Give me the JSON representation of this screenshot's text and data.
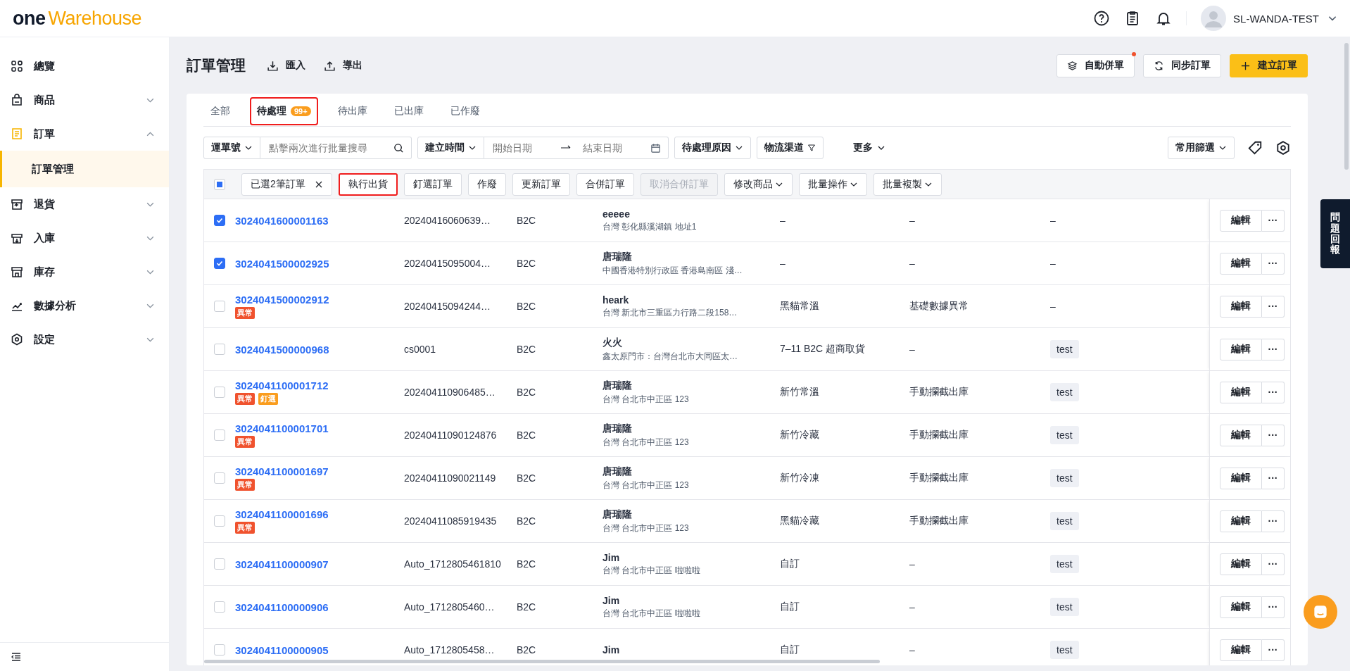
{
  "header": {
    "logo_one": "one",
    "logo_rest": "Warehouse",
    "user": "SL-WANDA-TEST"
  },
  "sidebar": {
    "items": [
      {
        "label": "總覽"
      },
      {
        "label": "商品",
        "expanded": false
      },
      {
        "label": "訂單",
        "expanded": true,
        "children": [
          {
            "label": "訂單管理",
            "selected": true
          }
        ]
      },
      {
        "label": "退貨",
        "expanded": false
      },
      {
        "label": "入庫",
        "expanded": false
      },
      {
        "label": "庫存",
        "expanded": false
      },
      {
        "label": "數據分析",
        "expanded": false
      },
      {
        "label": "設定",
        "expanded": false
      }
    ]
  },
  "page": {
    "title": "訂單管理",
    "import": "匯入",
    "export": "導出",
    "buttons": [
      {
        "label": "自動併單",
        "kind": "layers",
        "dot": true
      },
      {
        "label": "同步訂單",
        "kind": "sync",
        "dot": false
      },
      {
        "label": "建立訂單",
        "kind": "primary",
        "dot": false
      }
    ]
  },
  "tabs": [
    {
      "label": "全部",
      "selected": false,
      "highlighted": false
    },
    {
      "label": "待處理",
      "badge": "99+",
      "selected": true,
      "highlighted": true
    },
    {
      "label": "待出庫",
      "selected": false,
      "highlighted": false
    },
    {
      "label": "已出庫",
      "selected": false,
      "highlighted": false
    },
    {
      "label": "已作廢",
      "selected": false,
      "highlighted": false
    }
  ],
  "filters": {
    "search_type": "運單號",
    "search_placeholder": "點擊兩次進行批量搜尋",
    "date_type": "建立時間",
    "start_placeholder": "開始日期",
    "end_placeholder": "結束日期",
    "reason": "待處理原因",
    "channel": "物流渠道",
    "more": "更多",
    "saved": "常用篩選"
  },
  "bulk_bar": {
    "partially_checked": true,
    "selected_label": "已選2筆訂單",
    "actions": [
      {
        "label": "執行出貨",
        "disabled": false,
        "highlighted": true,
        "dropdown": false
      },
      {
        "label": "釘選訂單",
        "disabled": false,
        "highlighted": false,
        "dropdown": false
      },
      {
        "label": "作廢",
        "disabled": false,
        "highlighted": false,
        "dropdown": false
      },
      {
        "label": "更新訂單",
        "disabled": false,
        "highlighted": false,
        "dropdown": false
      },
      {
        "label": "合併訂單",
        "disabled": false,
        "highlighted": false,
        "dropdown": false
      },
      {
        "label": "取消合併訂單",
        "disabled": true,
        "highlighted": false,
        "dropdown": false
      },
      {
        "label": "修改商品",
        "disabled": false,
        "highlighted": false,
        "dropdown": true
      },
      {
        "label": "批量操作",
        "disabled": false,
        "highlighted": false,
        "dropdown": true
      },
      {
        "label": "批量複製",
        "disabled": false,
        "highlighted": false,
        "dropdown": true
      }
    ]
  },
  "table": {
    "rows": [
      {
        "checked": true,
        "order": "3024041600001163",
        "tags": [],
        "ref": "20240416060639…",
        "type": "B2C",
        "name": "eeeee",
        "address": "台灣 彰化縣溪湖鎮 地址1",
        "logistics": "–",
        "reason": "–",
        "tag": "–",
        "edit": "編輯",
        "more": "···"
      },
      {
        "checked": true,
        "order": "3024041500002925",
        "tags": [],
        "ref": "20240415095004…",
        "type": "B2C",
        "name": "唐瑞隆",
        "address": "中國香港特別行政區 香港島南區 淺…",
        "logistics": "–",
        "reason": "–",
        "tag": "–",
        "edit": "編輯",
        "more": "···"
      },
      {
        "checked": false,
        "order": "3024041500002912",
        "tags": [
          {
            "text": "異常",
            "kind": "error"
          }
        ],
        "ref": "20240415094244…",
        "type": "B2C",
        "name": "heark",
        "address": "台灣 新北市三重區力行路二段158…",
        "logistics": "黑貓常溫",
        "reason": "基礎數據異常",
        "tag": "–",
        "edit": "編輯",
        "more": "···"
      },
      {
        "checked": false,
        "order": "3024041500000968",
        "tags": [],
        "ref": "cs0001",
        "type": "B2C",
        "name": "火火",
        "address": "鑫太原門市：台灣台北市大同區太…",
        "logistics": "7–11 B2C 超商取貨",
        "reason": "–",
        "tag": "test",
        "edit": "編輯",
        "more": "···"
      },
      {
        "checked": false,
        "order": "3024041100001712",
        "tags": [
          {
            "text": "異常",
            "kind": "error"
          },
          {
            "text": "釘選",
            "kind": "pin"
          }
        ],
        "ref": "202404110906485…",
        "type": "B2C",
        "name": "唐瑞隆",
        "address": "台灣 台北市中正區 123",
        "logistics": "新竹常溫",
        "reason": "手動攔截出庫",
        "tag": "test",
        "edit": "編輯",
        "more": "···"
      },
      {
        "checked": false,
        "order": "3024041100001701",
        "tags": [
          {
            "text": "異常",
            "kind": "error"
          }
        ],
        "ref": "20240411090124876",
        "type": "B2C",
        "name": "唐瑞隆",
        "address": "台灣 台北市中正區 123",
        "logistics": "新竹冷藏",
        "reason": "手動攔截出庫",
        "tag": "test",
        "edit": "編輯",
        "more": "···"
      },
      {
        "checked": false,
        "order": "3024041100001697",
        "tags": [
          {
            "text": "異常",
            "kind": "error"
          }
        ],
        "ref": "20240411090021149",
        "type": "B2C",
        "name": "唐瑞隆",
        "address": "台灣 台北市中正區 123",
        "logistics": "新竹冷凍",
        "reason": "手動攔截出庫",
        "tag": "test",
        "edit": "編輯",
        "more": "···"
      },
      {
        "checked": false,
        "order": "3024041100001696",
        "tags": [
          {
            "text": "異常",
            "kind": "error"
          }
        ],
        "ref": "20240411085919435",
        "type": "B2C",
        "name": "唐瑞隆",
        "address": "台灣 台北市中正區 123",
        "logistics": "黑貓冷藏",
        "reason": "手動攔截出庫",
        "tag": "test",
        "edit": "編輯",
        "more": "···"
      },
      {
        "checked": false,
        "order": "3024041100000907",
        "tags": [],
        "ref": "Auto_1712805461810",
        "type": "B2C",
        "name": "Jim",
        "address": "台灣 台北市中正區 啦啦啦",
        "logistics": "自訂",
        "reason": "–",
        "tag": "test",
        "edit": "編輯",
        "more": "···"
      },
      {
        "checked": false,
        "order": "3024041100000906",
        "tags": [],
        "ref": "Auto_1712805460…",
        "type": "B2C",
        "name": "Jim",
        "address": "台灣 台北市中正區 啦啦啦",
        "logistics": "自訂",
        "reason": "–",
        "tag": "test",
        "edit": "編輯",
        "more": "···"
      },
      {
        "checked": false,
        "order": "3024041100000905",
        "tags": [],
        "ref": "Auto_1712805458…",
        "type": "B2C",
        "name": "Jim",
        "logistics": "自訂",
        "reason": "–",
        "tag": "test",
        "edit": "編輯",
        "more": "···"
      }
    ]
  },
  "feedback": {
    "label": "問題回報"
  }
}
